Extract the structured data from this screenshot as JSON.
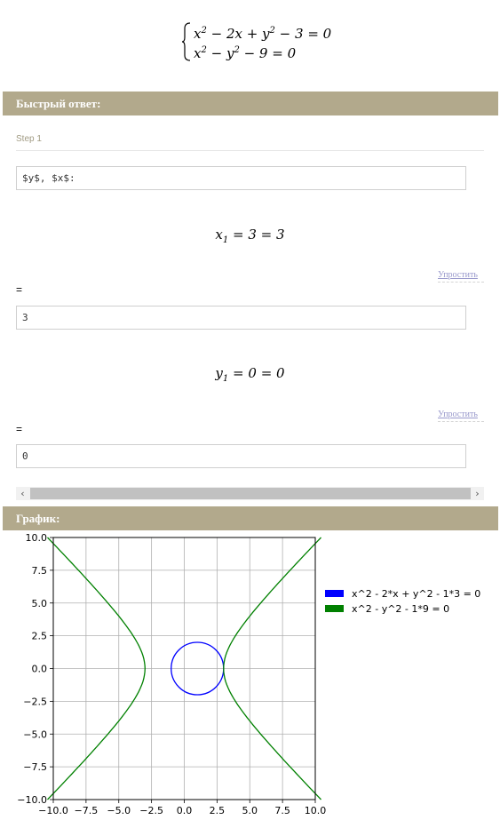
{
  "system": {
    "eq1": "x² − 2x + y² − 3 = 0",
    "eq2": "x² − y² − 9 = 0"
  },
  "quick_answer": {
    "header": "Быстрый ответ:",
    "step_label": "Step 1",
    "step_field": "$y$, $x$:",
    "x_line": {
      "var": "x",
      "sub": "1",
      "rest": " = 3 = 3"
    },
    "simplify_label": "Упростить",
    "equals": "=",
    "x_value": "3",
    "y_line": {
      "var": "y",
      "sub": "1",
      "rest": " = 0 = 0"
    },
    "y_value": "0"
  },
  "graph": {
    "header": "График:"
  },
  "chart_data": {
    "type": "line",
    "title": "",
    "xlabel": "",
    "ylabel": "",
    "xlim": [
      -10,
      10
    ],
    "ylim": [
      -10,
      10
    ],
    "xticks": [
      "−10.0",
      "−7.5",
      "−5.0",
      "−2.5",
      "0.0",
      "2.5",
      "5.0",
      "7.5",
      "10.0"
    ],
    "yticks": [
      "10.0",
      "7.5",
      "5.0",
      "2.5",
      "0.0",
      "−2.5",
      "−5.0",
      "−7.5",
      "−10.0"
    ],
    "grid": true,
    "legend_position": "right",
    "series": [
      {
        "name": "x^2 - 2*x + y^2 - 1*3 = 0",
        "color": "#0000ff",
        "shape": "circle",
        "center": [
          1,
          0
        ],
        "radius": 2
      },
      {
        "name": "x^2 - y^2 - 1*9 = 0",
        "color": "#008000",
        "shape": "hyperbola",
        "a": 3
      }
    ]
  }
}
